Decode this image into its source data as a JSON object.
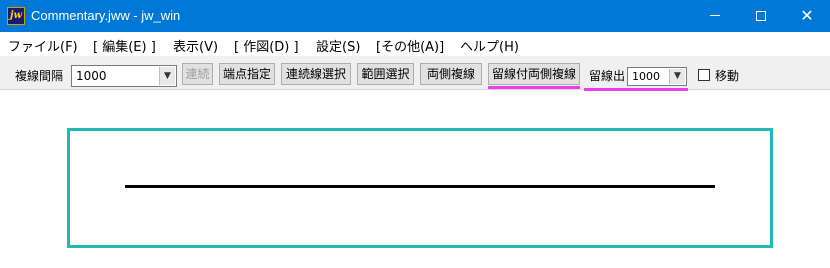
{
  "window": {
    "title": "Commentary.jww - jw_win",
    "app_icon": "jw",
    "controls": {
      "minimize": "minimize-icon",
      "maximize": "maximize-icon",
      "close": "✕"
    }
  },
  "menu": {
    "items": [
      "ファイル(F)",
      "[ 編集(E) ]",
      "表示(V)",
      "[ 作図(D) ]",
      "設定(S)",
      "[その他(A)]",
      "ヘルプ(H)"
    ]
  },
  "toolbar": {
    "spacing_label": "複線間隔",
    "spacing_value": "1000",
    "buttons": [
      "連続",
      "端点指定",
      "連続線選択",
      "範囲選択",
      "両側複線",
      "留線付両側複線"
    ],
    "disabled_button": "連続",
    "stop_line_label": "留線出",
    "stop_line_value": "1000",
    "move_label": "移動",
    "move_checked": false
  },
  "colors": {
    "title_bar": "#0078d7",
    "frame": "#21b8b8",
    "highlight": "#e83fe8",
    "line": "#000000"
  }
}
